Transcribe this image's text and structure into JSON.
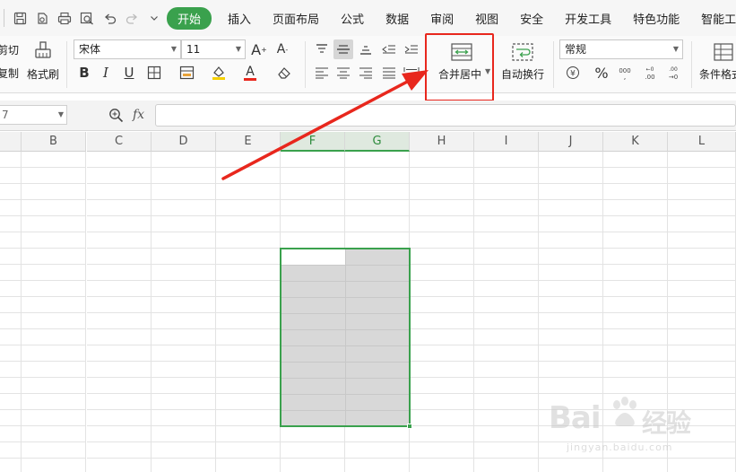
{
  "quick_access": {
    "icons": [
      "save-icon",
      "print-preview-icon",
      "print-icon",
      "zoom-icon",
      "undo-icon",
      "redo-icon",
      "dropdown-icon"
    ]
  },
  "tabs": [
    "开始",
    "插入",
    "页面布局",
    "公式",
    "数据",
    "审阅",
    "视图",
    "安全",
    "开发工具",
    "特色功能",
    "智能工具"
  ],
  "active_tab": "开始",
  "ribbon": {
    "cut_label": "剪切",
    "copy_label": "复制",
    "format_painter_label": "格式刷",
    "font_name": "宋体",
    "font_size": "11",
    "bold": "B",
    "italic": "I",
    "underline": "U",
    "font_color_glyph": "A",
    "merge_center_label": "合并居中",
    "wrap_text_label": "自动换行",
    "number_format": "常规",
    "percent": "%",
    "conditional_format_label": "条件格式"
  },
  "formula_bar": {
    "name_box": "7",
    "fx_label": "fx",
    "formula": ""
  },
  "columns": [
    "B",
    "C",
    "D",
    "E",
    "F",
    "G",
    "H",
    "I",
    "J",
    "K",
    "L"
  ],
  "selected_columns": [
    "F",
    "G"
  ],
  "colors": {
    "active_tab": "#3aa14d",
    "highlight": "#e8271d",
    "selection_border": "#3aa14d",
    "selection_fill": "#d8d8d8"
  },
  "watermark": {
    "brand": "Bai",
    "suffix": "经验",
    "url": "jingyan.baidu.com"
  }
}
